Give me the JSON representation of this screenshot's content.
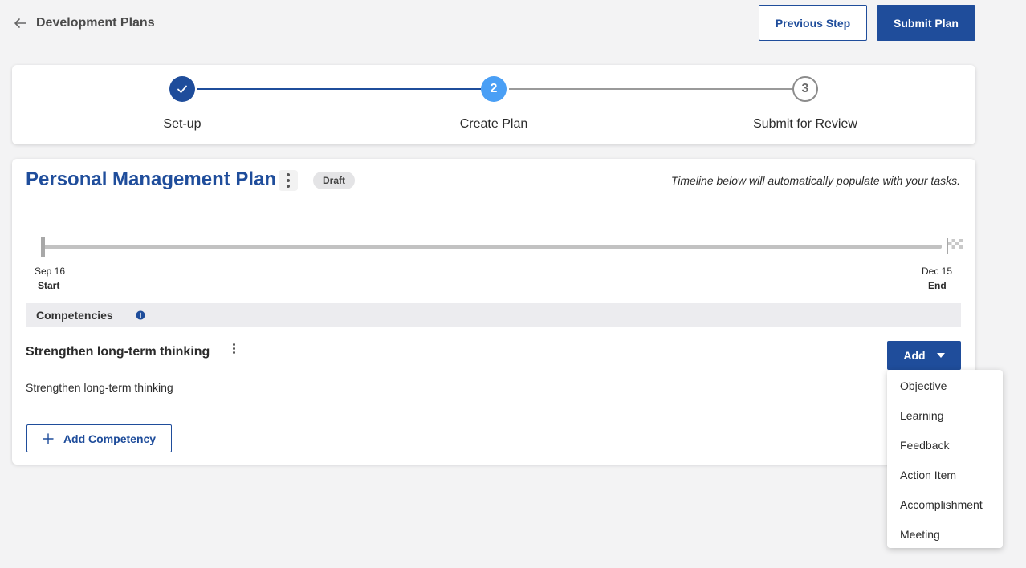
{
  "header": {
    "title": "Development Plans",
    "previous_step_label": "Previous Step",
    "submit_plan_label": "Submit Plan"
  },
  "stepper": {
    "steps": [
      {
        "label": "Set-up",
        "number": "1",
        "state": "complete"
      },
      {
        "label": "Create Plan",
        "number": "2",
        "state": "current"
      },
      {
        "label": "Submit for Review",
        "number": "3",
        "state": "upcoming"
      }
    ]
  },
  "plan": {
    "title": "Personal Management Plan",
    "status_badge": "Draft",
    "timeline_note": "Timeline below will automatically populate with your tasks.",
    "timeline": {
      "start_date": "Sep 16",
      "start_label": "Start",
      "end_date": "Dec 15",
      "end_label": "End"
    },
    "competencies_header": "Competencies",
    "competency": {
      "title": "Strengthen long-term thinking",
      "description": "Strengthen long-term thinking"
    },
    "add_label": "Add",
    "add_competency_label": "Add Competency"
  },
  "dropdown": {
    "items": [
      "Objective",
      "Learning",
      "Feedback",
      "Action Item",
      "Accomplishment",
      "Meeting"
    ]
  },
  "colors": {
    "primary": "#1f4d9b",
    "current_step": "#4a9ff5",
    "background": "#f3f3f4"
  }
}
